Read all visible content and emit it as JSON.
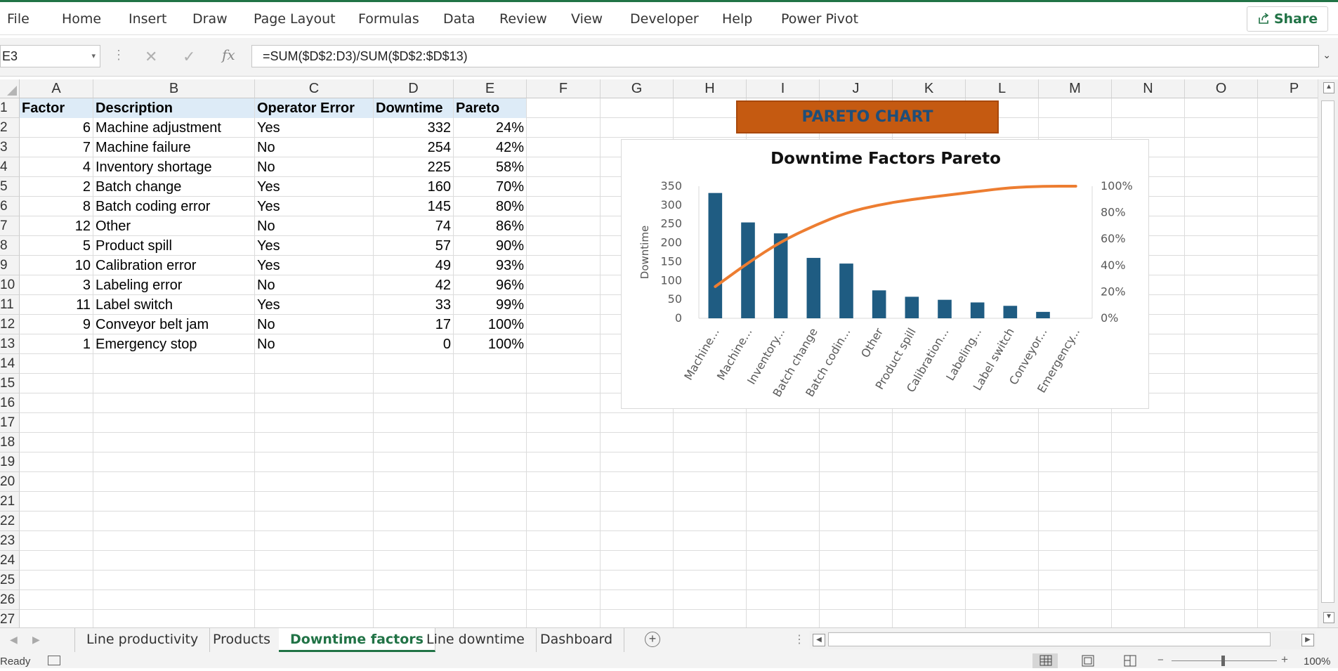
{
  "menu": {
    "tabs": [
      "File",
      "Home",
      "Insert",
      "Draw",
      "Page Layout",
      "Formulas",
      "Data",
      "Review",
      "View",
      "Developer",
      "Help",
      "Power Pivot"
    ],
    "share_label": "Share"
  },
  "formula_bar": {
    "name_box": "E3",
    "formula": "=SUM($D$2:D3)/SUM($D$2:$D$13)",
    "fx_label": "fx"
  },
  "columns": [
    "A",
    "B",
    "C",
    "D",
    "E",
    "F",
    "G",
    "H",
    "I",
    "J",
    "K",
    "L",
    "M",
    "N",
    "O",
    "P"
  ],
  "rows": [
    "1",
    "2",
    "3",
    "4",
    "5",
    "6",
    "7",
    "8",
    "9",
    "10",
    "11",
    "12",
    "13",
    "14",
    "15",
    "16",
    "17",
    "18",
    "19",
    "20",
    "21",
    "22",
    "23",
    "24",
    "25",
    "26",
    "27"
  ],
  "table": {
    "headers": [
      "Factor",
      "Description",
      "Operator Error",
      "Downtime",
      "Pareto"
    ],
    "rows": [
      [
        "6",
        "Machine adjustment",
        "Yes",
        "332",
        "24%"
      ],
      [
        "7",
        "Machine failure",
        "No",
        "254",
        "42%"
      ],
      [
        "4",
        "Inventory shortage",
        "No",
        "225",
        "58%"
      ],
      [
        "2",
        "Batch change",
        "Yes",
        "160",
        "70%"
      ],
      [
        "8",
        "Batch coding error",
        "Yes",
        "145",
        "80%"
      ],
      [
        "12",
        "Other",
        "No",
        "74",
        "86%"
      ],
      [
        "5",
        "Product spill",
        "Yes",
        "57",
        "90%"
      ],
      [
        "10",
        "Calibration error",
        "Yes",
        "49",
        "93%"
      ],
      [
        "3",
        "Labeling error",
        "No",
        "42",
        "96%"
      ],
      [
        "11",
        "Label switch",
        "Yes",
        "33",
        "99%"
      ],
      [
        "9",
        "Conveyor belt jam",
        "No",
        "17",
        "100%"
      ],
      [
        "1",
        "Emergency stop",
        "No",
        "0",
        "100%"
      ]
    ]
  },
  "banner": {
    "text": "PARETO CHART",
    "color": "#c55a11"
  },
  "chart_data": {
    "type": "bar",
    "title": "Downtime Factors Pareto",
    "ylabel": "Downtime",
    "categories": [
      "Machine...",
      "Machine...",
      "Inventory...",
      "Batch change",
      "Batch codin...",
      "Other",
      "Product spill",
      "Calibration...",
      "Labeling...",
      "Label switch",
      "Conveyor...",
      "Emergency..."
    ],
    "series": [
      {
        "type": "bar",
        "values": [
          332,
          254,
          225,
          160,
          145,
          74,
          57,
          49,
          42,
          33,
          17,
          0
        ],
        "color": "#1f5c82",
        "axis": "left"
      },
      {
        "type": "line",
        "values": [
          0.24,
          0.42,
          0.58,
          0.7,
          0.8,
          0.86,
          0.9,
          0.93,
          0.96,
          0.99,
          1.0,
          1.0
        ],
        "color": "#ed7d31",
        "axis": "right"
      }
    ],
    "ylim": [
      0,
      350
    ],
    "yticks": [
      "0",
      "50",
      "100",
      "150",
      "200",
      "250",
      "300",
      "350"
    ],
    "y2lim": [
      0,
      1
    ],
    "y2ticks": [
      "0%",
      "20%",
      "40%",
      "60%",
      "80%",
      "100%"
    ],
    "grid": false
  },
  "sheets": {
    "tabs": [
      "Line productivity",
      "Products",
      "Downtime factors",
      "Line downtime",
      "Dashboard"
    ],
    "active": "Downtime factors"
  },
  "status": {
    "ready": "Ready",
    "zoom": "100%"
  }
}
